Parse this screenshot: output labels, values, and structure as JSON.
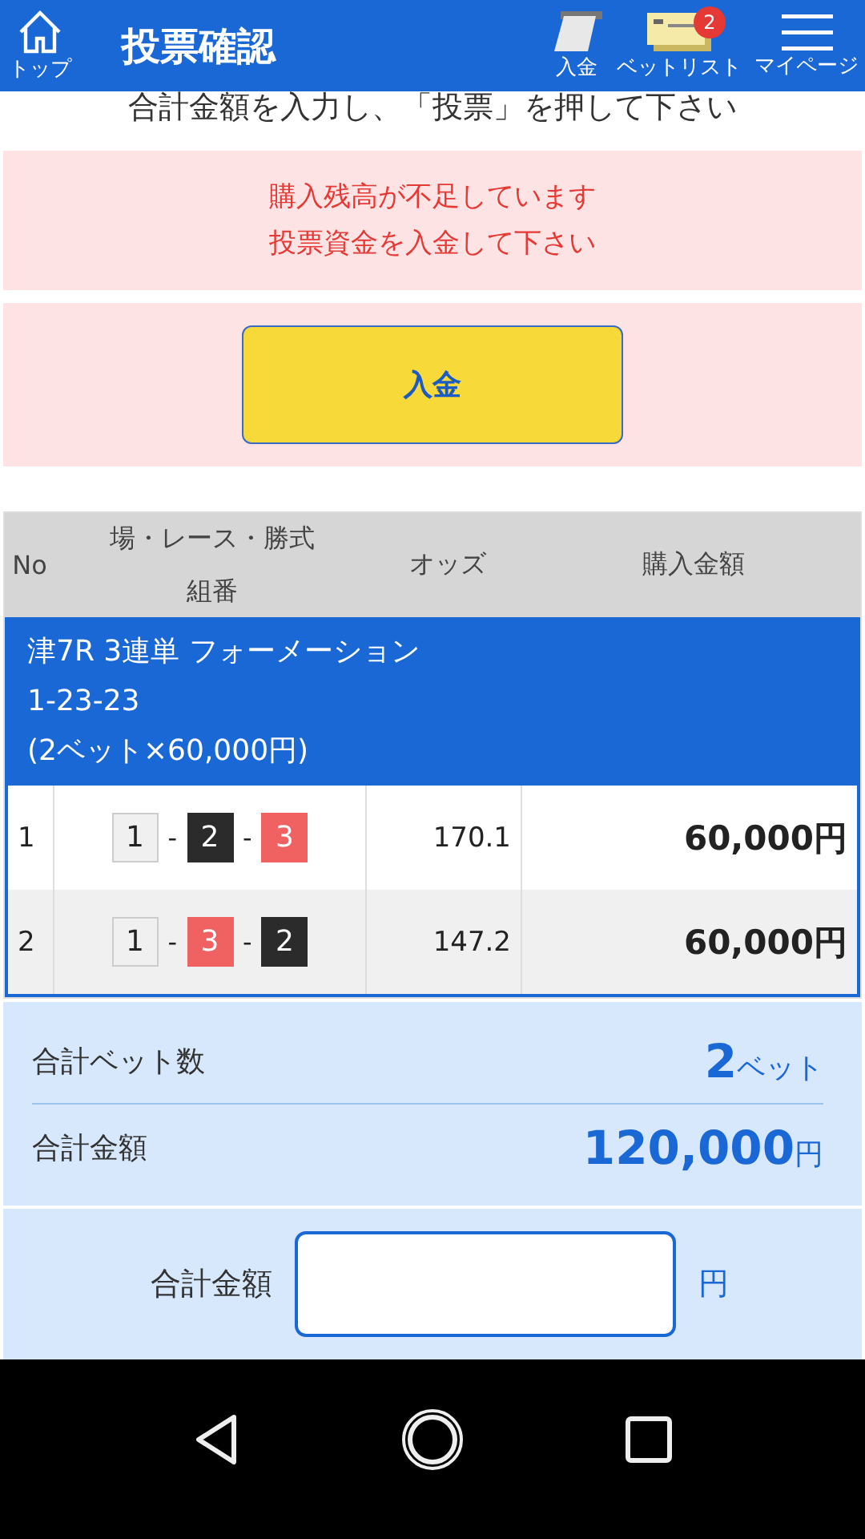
{
  "header": {
    "home_label": "トップ",
    "title": "投票確認",
    "actions": [
      {
        "kind": "deposit",
        "label": "入金"
      },
      {
        "kind": "betlist",
        "label": "ベットリスト",
        "badge": "2"
      },
      {
        "kind": "menu",
        "label": "マイページ"
      }
    ]
  },
  "instruction": "合計金額を入力し、「投票」を押して下さい",
  "alert": [
    "購入残高が不足しています",
    "投票資金を入金して下さい"
  ],
  "deposit_button": "入金",
  "table": {
    "columns": {
      "no": "No",
      "race": "場・レース・勝式",
      "combo": "組番",
      "odds": "オッズ",
      "amount": "購入金額"
    },
    "group": [
      "津7R 3連単 フォーメーション",
      "1-23-23",
      "(2ベット×60,000円)"
    ],
    "rows": [
      {
        "no": "1",
        "picks": [
          {
            "number": "1",
            "color": "#f0f0f0"
          },
          {
            "number": "2",
            "color": "#2b2b2b"
          },
          {
            "number": "3",
            "color": "#f06262"
          }
        ],
        "separator": "-",
        "odds": "170.1",
        "amount": "60,000円"
      },
      {
        "no": "2",
        "picks": [
          {
            "number": "1",
            "color": "#f0f0f0"
          },
          {
            "number": "3",
            "color": "#f06262"
          },
          {
            "number": "2",
            "color": "#2b2b2b"
          }
        ],
        "separator": "-",
        "odds": "147.2",
        "amount": "60,000円"
      }
    ]
  },
  "summary": [
    {
      "label": "合計ベット数",
      "value": "2",
      "unit": "ベット"
    },
    {
      "label": "合計金額",
      "value": "120,000",
      "unit": "円"
    }
  ],
  "amount_input": {
    "label": "合計金額",
    "unit": "円"
  }
}
